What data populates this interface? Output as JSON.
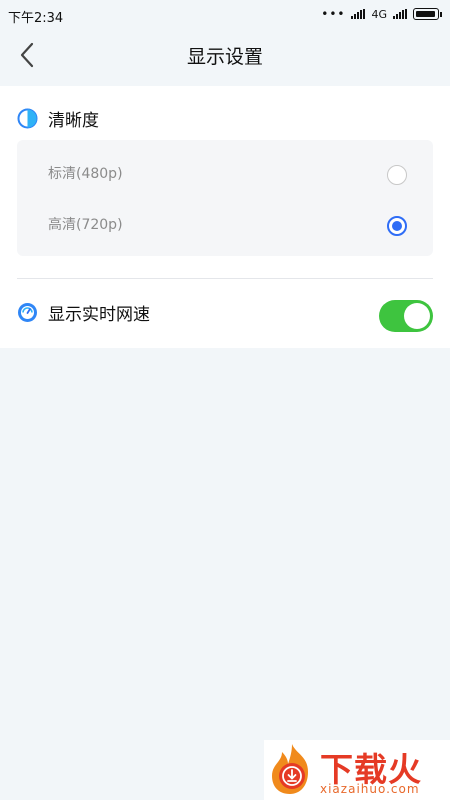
{
  "status_bar": {
    "time": "下午2:34",
    "dots": "•••",
    "network": "4G"
  },
  "nav": {
    "title": "显示设置"
  },
  "resolution": {
    "title": "清晰度",
    "options": [
      {
        "label": "标清(480p)",
        "selected": false
      },
      {
        "label": "高清(720p)",
        "selected": true
      }
    ]
  },
  "speed": {
    "title": "显示实时网速",
    "enabled": true
  },
  "watermark": {
    "brand": "下载火",
    "url": "xiazaihuo.com"
  },
  "colors": {
    "accent": "#2f6df6",
    "toggle_on": "#3ec43f",
    "background": "#f2f6f9"
  }
}
